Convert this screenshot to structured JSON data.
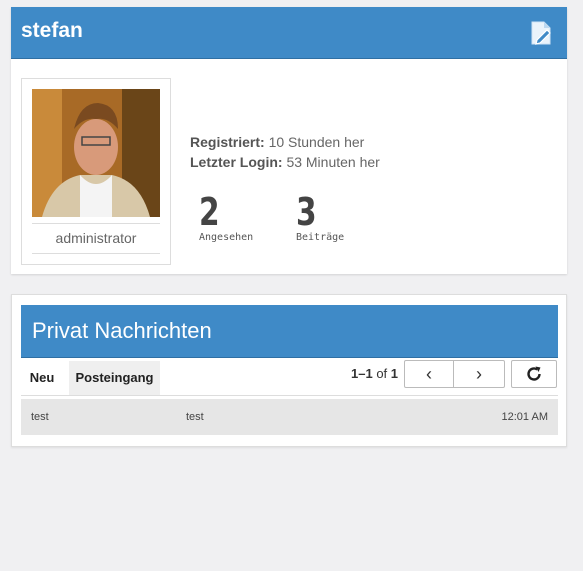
{
  "profile": {
    "username": "stefan",
    "role": "administrator",
    "registered_label": "Registriert:",
    "registered_value": "10 Stunden her",
    "last_login_label": "Letzter Login:",
    "last_login_value": "53 Minuten her",
    "stats": [
      {
        "value": "2",
        "label": "Angesehen"
      },
      {
        "value": "3",
        "label": "Beiträge"
      }
    ],
    "edit_icon": "edit-profile-icon",
    "accent_color": "#3f8ac7"
  },
  "messages": {
    "title": "Privat Nachrichten",
    "tabs": [
      {
        "label": "Neu"
      },
      {
        "label": "Posteingang"
      }
    ],
    "pager": {
      "range": "1–1",
      "of": "of",
      "total": "1"
    },
    "buttons": {
      "prev": "‹",
      "next": "›",
      "refresh": "⟳"
    },
    "rows": [
      {
        "from": "test",
        "subject": "test",
        "time": "12:01 AM"
      }
    ]
  }
}
